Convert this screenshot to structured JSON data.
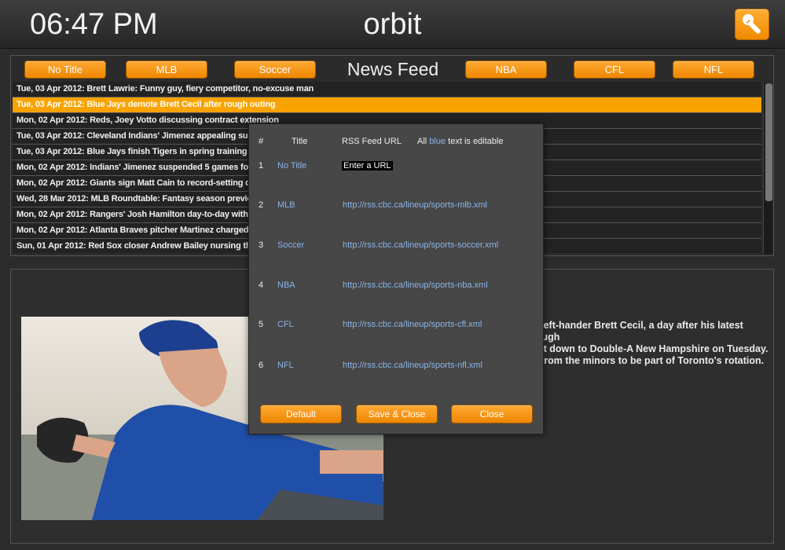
{
  "header": {
    "clock": "06:47 PM",
    "app_title": "orbit"
  },
  "feed_tabs": [
    {
      "label": "No Title"
    },
    {
      "label": "MLB"
    },
    {
      "label": "Soccer"
    },
    {
      "label": "NBA"
    },
    {
      "label": "CFL"
    },
    {
      "label": "NFL"
    }
  ],
  "feed_title": "News Feed",
  "news_items": [
    "Tue, 03 Apr 2012: Brett Lawrie: Funny guy, fiery competitor, no-excuse man",
    "Tue, 03 Apr 2012: Blue Jays demote Brett Cecil after rough outing",
    "Mon, 02 Apr 2012: Reds, Joey Votto discussing contract extension",
    "Tue, 03 Apr 2012: Cleveland Indians' Jimenez appealing suspens",
    "Tue, 03 Apr 2012: Blue Jays finish Tigers in spring training",
    "Mon, 02 Apr 2012: Indians' Jimenez suspended 5 games for throw",
    "Mon, 02 Apr 2012: Giants sign Matt Cain to record-setting deal",
    "Wed, 28 Mar 2012: MLB Roundtable: Fantasy season preview",
    "Mon, 02 Apr 2012: Rangers' Josh Hamilton day-to-day with migra",
    "Mon, 02 Apr 2012: Atlanta Braves pitcher Martinez charged with",
    "Sun, 01 Apr 2012: Red Sox closer Andrew Bailey nursing thumb i"
  ],
  "selected_index": 1,
  "article": {
    "lines": [
      "d left-hander Brett Cecil, a day after his latest rough",
      "ent down to Double-A New Hampshire on Tuesday.",
      "d from the minors to be part of Toronto's rotation."
    ]
  },
  "dialog": {
    "col_number": "#",
    "col_title": "Title",
    "col_url": "RSS Feed URL",
    "note_prefix": "All",
    "note_blue": "blue",
    "note_suffix": "text is editable",
    "feeds": [
      {
        "num": "1",
        "title": "No Title",
        "url": "Enter a URL"
      },
      {
        "num": "2",
        "title": "MLB",
        "url": "http://rss.cbc.ca/lineup/sports-mlb.xml"
      },
      {
        "num": "3",
        "title": "Soccer",
        "url": "http://rss.cbc.ca/lineup/sports-soccer.xml"
      },
      {
        "num": "4",
        "title": "NBA",
        "url": "http://rss.cbc.ca/lineup/sports-nba.xml"
      },
      {
        "num": "5",
        "title": "CFL",
        "url": "http://rss.cbc.ca/lineup/sports-cfl.xml"
      },
      {
        "num": "6",
        "title": "NFL",
        "url": "http://rss.cbc.ca/lineup/sports-nfl.xml"
      }
    ],
    "buttons": {
      "default": "Default",
      "save_close": "Save & Close",
      "close": "Close"
    }
  },
  "colors": {
    "accent": "#f9a300",
    "editable": "#8ab4e8"
  },
  "icons": {
    "settings": "wrench-icon"
  }
}
